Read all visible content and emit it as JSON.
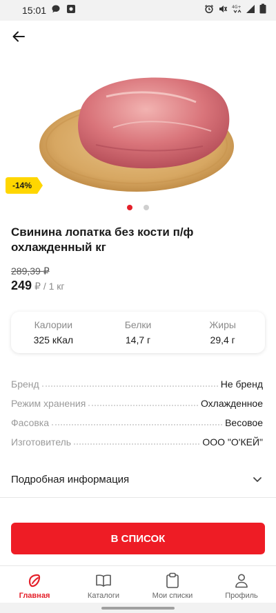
{
  "status_bar": {
    "time": "15:01",
    "icons": [
      "chat-icon",
      "app-notification-icon",
      "alarm-icon",
      "mute-icon",
      "network-4g-icon",
      "signal-icon",
      "battery-icon"
    ]
  },
  "product": {
    "discount": "-14%",
    "title": "Свинина лопатка без кости п/ф охлажденный кг",
    "old_price": "289,39 ₽",
    "price": "249",
    "price_unit": "₽ / 1 кг",
    "images_count": 2,
    "active_image": 1
  },
  "nutrition": [
    {
      "label": "Калории",
      "value": "325 кКал"
    },
    {
      "label": "Белки",
      "value": "14,7 г"
    },
    {
      "label": "Жиры",
      "value": "29,4 г"
    }
  ],
  "specs": [
    {
      "label": "Бренд",
      "value": "Не бренд"
    },
    {
      "label": "Режим хранения",
      "value": "Охлажденное"
    },
    {
      "label": "Фасовка",
      "value": "Весовое"
    },
    {
      "label": "Изготовитель",
      "value": "ООО \"О'КЕЙ\""
    }
  ],
  "details": {
    "label": "Подробная информация"
  },
  "cta": {
    "label": "В СПИСОК"
  },
  "bottom_nav": [
    {
      "label": "Главная",
      "icon": "home-leaf-icon",
      "active": true
    },
    {
      "label": "Каталоги",
      "icon": "book-icon",
      "active": false
    },
    {
      "label": "Мои списки",
      "icon": "clipboard-icon",
      "active": false
    },
    {
      "label": "Профиль",
      "icon": "profile-icon",
      "active": false
    }
  ],
  "colors": {
    "accent": "#ee1c25",
    "badge": "#ffd600",
    "muted": "#9a9a9a"
  }
}
